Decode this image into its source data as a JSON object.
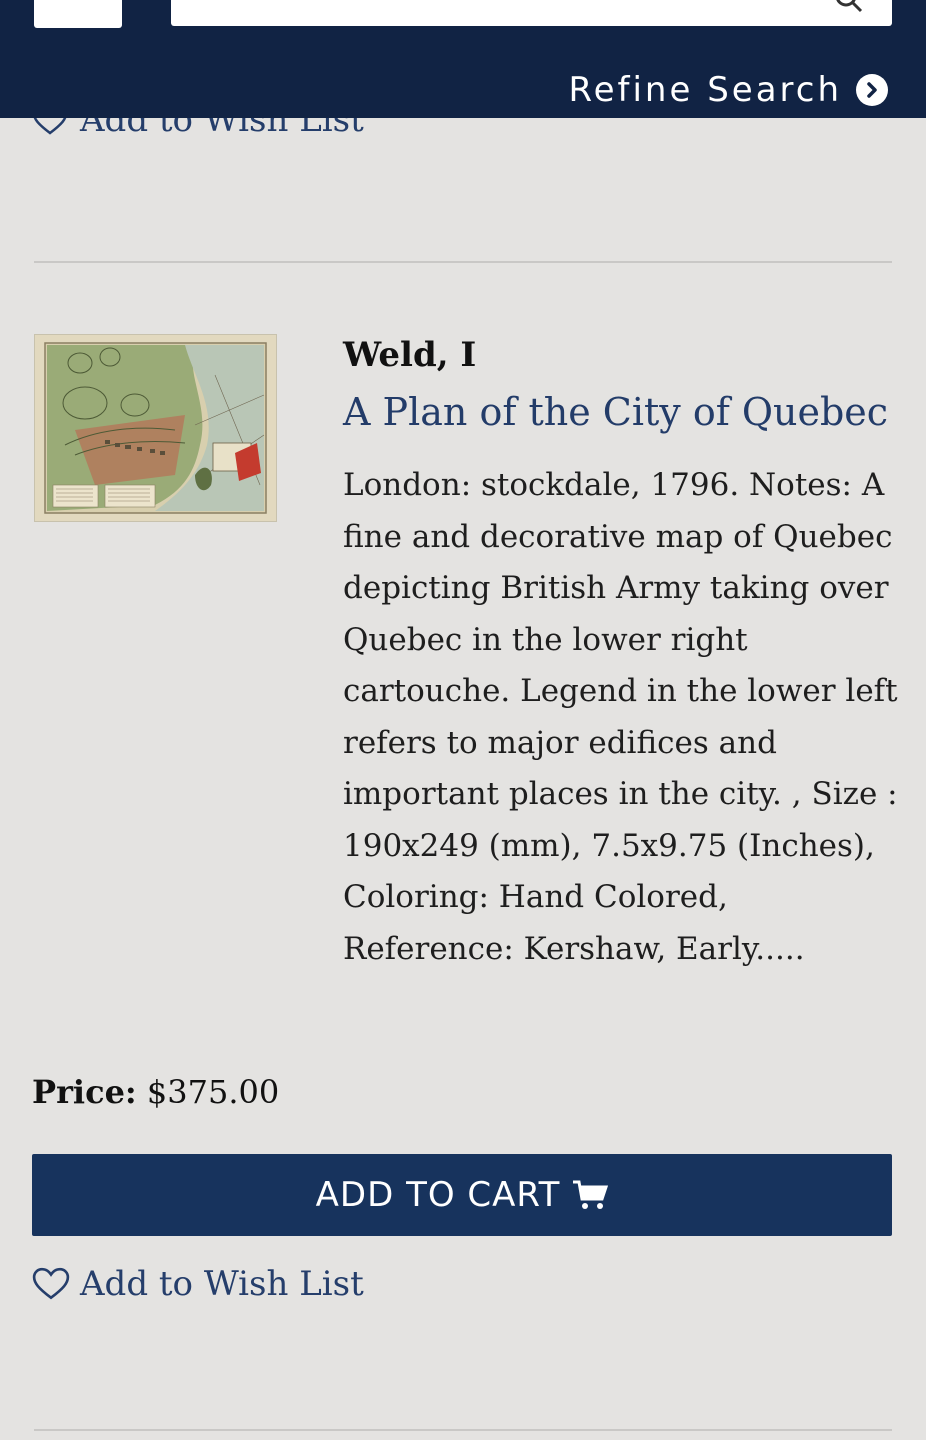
{
  "header": {
    "refine_label": "Refine Search"
  },
  "listing": {
    "prev_wishlist_label": "Add to Wish List",
    "author": "Weld, I",
    "title": "A Plan of the City of Quebec",
    "description": "London: stockdale, 1796. Notes: A fine and decorative map of Quebec depicting British Army taking over Quebec in the lower right cartouche. Legend in the lower left refers to major edifices and important places in the city. , Size : 190x249 (mm), 7.5x9.75 (Inches), Coloring: Hand Colored, Reference: Kershaw, Early.....",
    "price_label": "Price:",
    "price_value": "$375.00",
    "add_to_cart_label": "ADD TO CART",
    "wishlist_label": "Add to Wish List"
  },
  "colors": {
    "header_bg": "#112344",
    "button_bg": "#17335d",
    "link": "#253e6b",
    "page_bg": "#e4e3e1"
  },
  "icons": {
    "refine": "chevron-circle-right-icon",
    "cart": "shopping-cart-icon",
    "wishlist": "heart-outline-icon",
    "search": "search-icon"
  }
}
